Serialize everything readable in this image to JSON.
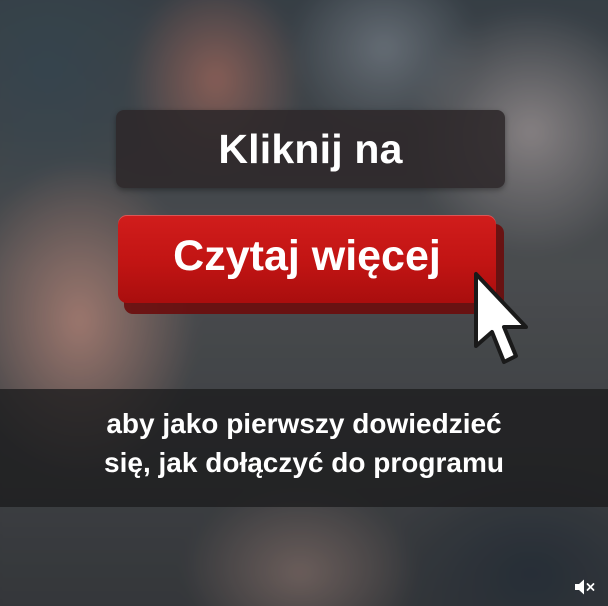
{
  "headline": {
    "text": "Kliknij na"
  },
  "cta_button": {
    "label": "Czytaj więcej",
    "color": "#c91818"
  },
  "cursor": {
    "icon": "pointer-arrow-icon"
  },
  "caption": {
    "line1": "aby jako pierwszy dowiedzieć",
    "line2": "się, jak dołączyć do programu"
  },
  "controls": {
    "volume_icon": "speaker-muted-icon"
  }
}
